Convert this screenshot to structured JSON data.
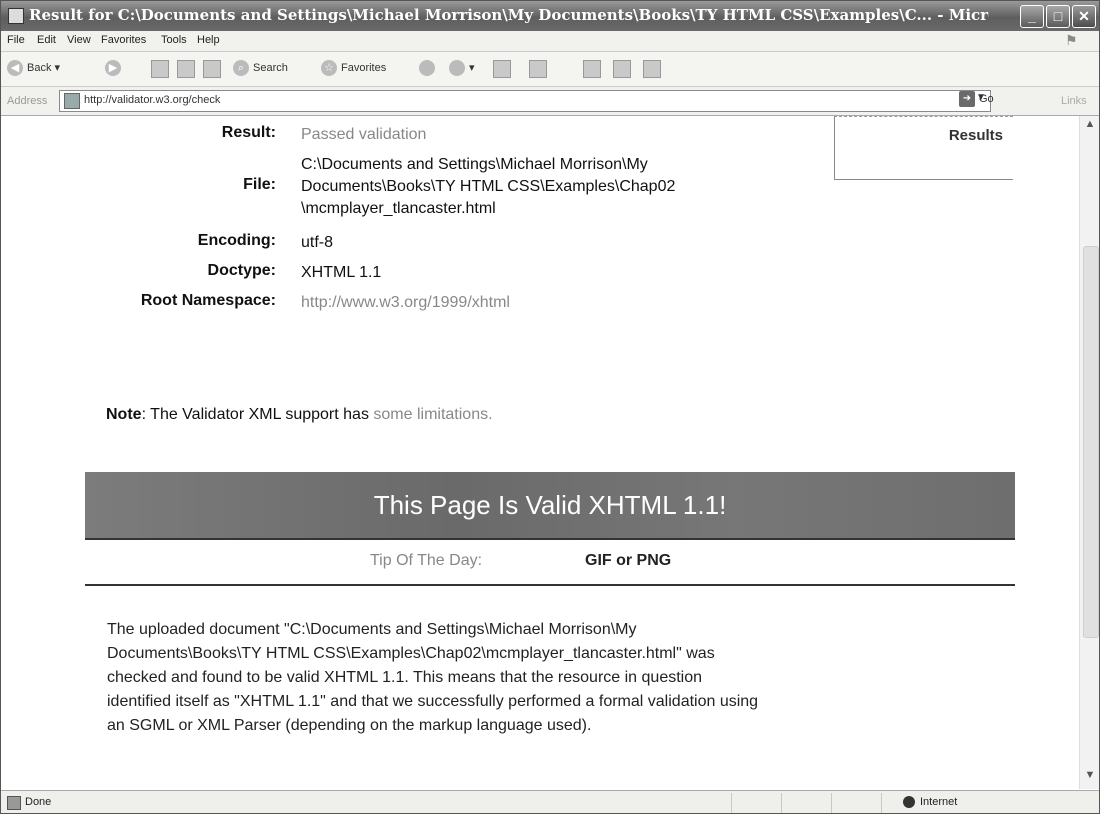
{
  "window": {
    "title": "Result for C:\\Documents and Settings\\Michael Morrison\\My Documents\\Books\\TY HTML CSS\\Examples\\C... - Micro..."
  },
  "menu": [
    "File",
    "Edit",
    "View",
    "Favorites",
    "Tools",
    "Help"
  ],
  "toolbar": {
    "back_label": "Back",
    "search_label": "Search",
    "favorites_label": "Favorites"
  },
  "address": {
    "label": "Address",
    "url": "http://validator.w3.org/check",
    "go_label": "Go",
    "links_label": "Links"
  },
  "results_tab": {
    "label": "Results"
  },
  "meta": {
    "result": {
      "key": "Result:",
      "value": "Passed validation"
    },
    "file": {
      "key": "File:",
      "lines": [
        "C:\\Documents and Settings\\Michael Morrison\\My",
        "Documents\\Books\\TY HTML CSS\\Examples\\Chap02",
        "\\mcmplayer_tlancaster.html"
      ]
    },
    "encoding": {
      "key": "Encoding:",
      "value": "utf-8"
    },
    "doctype": {
      "key": "Doctype:",
      "value": "XHTML 1.1"
    },
    "namespace": {
      "key": "Root Namespace:",
      "value": "http://www.w3.org/1999/xhtml"
    }
  },
  "note": {
    "bold": "Note",
    "text": ": The Validator XML support has ",
    "link": "some limitations."
  },
  "banner": {
    "text": "This Page Is Valid XHTML 1.1!"
  },
  "tip": {
    "label": "Tip Of The Day:",
    "value": "GIF or PNG"
  },
  "description": [
    "The uploaded document \"C:\\Documents and Settings\\Michael Morrison\\My",
    "Documents\\Books\\TY HTML CSS\\Examples\\Chap02\\mcmplayer_tlancaster.html\" was",
    "checked and found to be valid XHTML 1.1. This means that the resource in question",
    "identified itself as \"XHTML 1.1\" and that we successfully performed a formal validation using",
    "an SGML or XML Parser (depending on the markup language used)."
  ],
  "status": {
    "text": "Done",
    "zone": "Internet"
  }
}
